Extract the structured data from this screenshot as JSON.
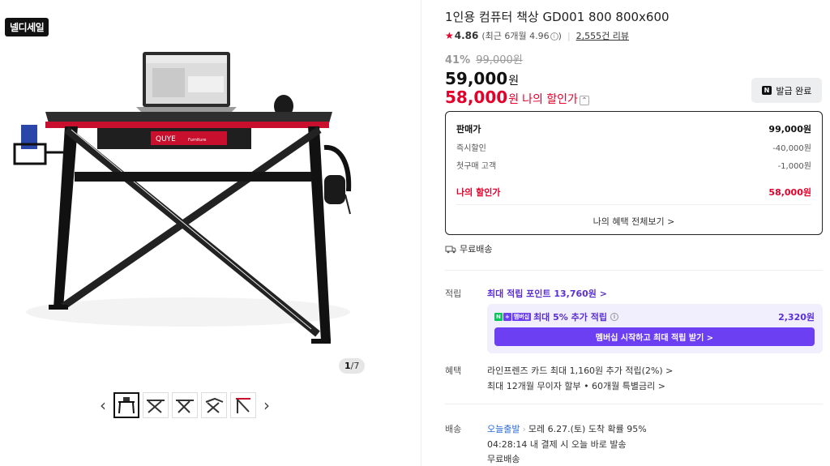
{
  "badge": "넬디세일",
  "gallery": {
    "counter_current": "1",
    "counter_total": "/7",
    "prev_arrow": "‹",
    "next_arrow": "›",
    "brand_text": "QUYE",
    "brand_sub": "Furniture"
  },
  "product": {
    "title": "1인용 컴퓨터 책상 GD001 800 800x600",
    "rating_score": "4.86",
    "rating_recent": "(최근 6개월 4.96",
    "rating_recent_close": ")",
    "review_count": "2,555건 리뷰",
    "discount_rate": "41%",
    "original_price": "99,000원",
    "price": "59,000",
    "price_unit": "원",
    "my_price": "58,000",
    "my_price_unit": "원",
    "my_price_label": "나의 할인가",
    "coupon_button": "발급 완료",
    "coupon_icon": "N"
  },
  "breakdown": {
    "rows": [
      {
        "label": "판매가",
        "value": "99,000원"
      },
      {
        "label": "즉시할인",
        "value": "-40,000원"
      },
      {
        "label": "첫구매 고객",
        "value": "-1,000원"
      }
    ],
    "my_label": "나의 할인가",
    "my_value": "58,000원",
    "more": "나의 혜택 전체보기 >"
  },
  "shipping_free": "무료배송",
  "points": {
    "label": "적립",
    "link": "최대 적립 포인트 13,760원 >",
    "membership_text": "최대 5% 추가 적립",
    "membership_amount": "2,320원",
    "membership_button": "멤버십 시작하고 최대 적립 받기 >",
    "badge_n": "N",
    "badge_plus": "+",
    "badge_mem": "멤버십"
  },
  "benefits": {
    "label": "혜택",
    "lines": [
      "라인프렌즈 카드 최대 1,160원 추가 적립(2%) >",
      "최대 12개월 무이자 할부 • 60개월 특별금리 >"
    ]
  },
  "delivery": {
    "label": "배송",
    "service": "오늘출발",
    "arrival": "모레 6.27.(토) 도착 확률 95%",
    "countdown": "04:28:14  내 결제 시 오늘 바로 발송",
    "fee": "무료배송"
  }
}
